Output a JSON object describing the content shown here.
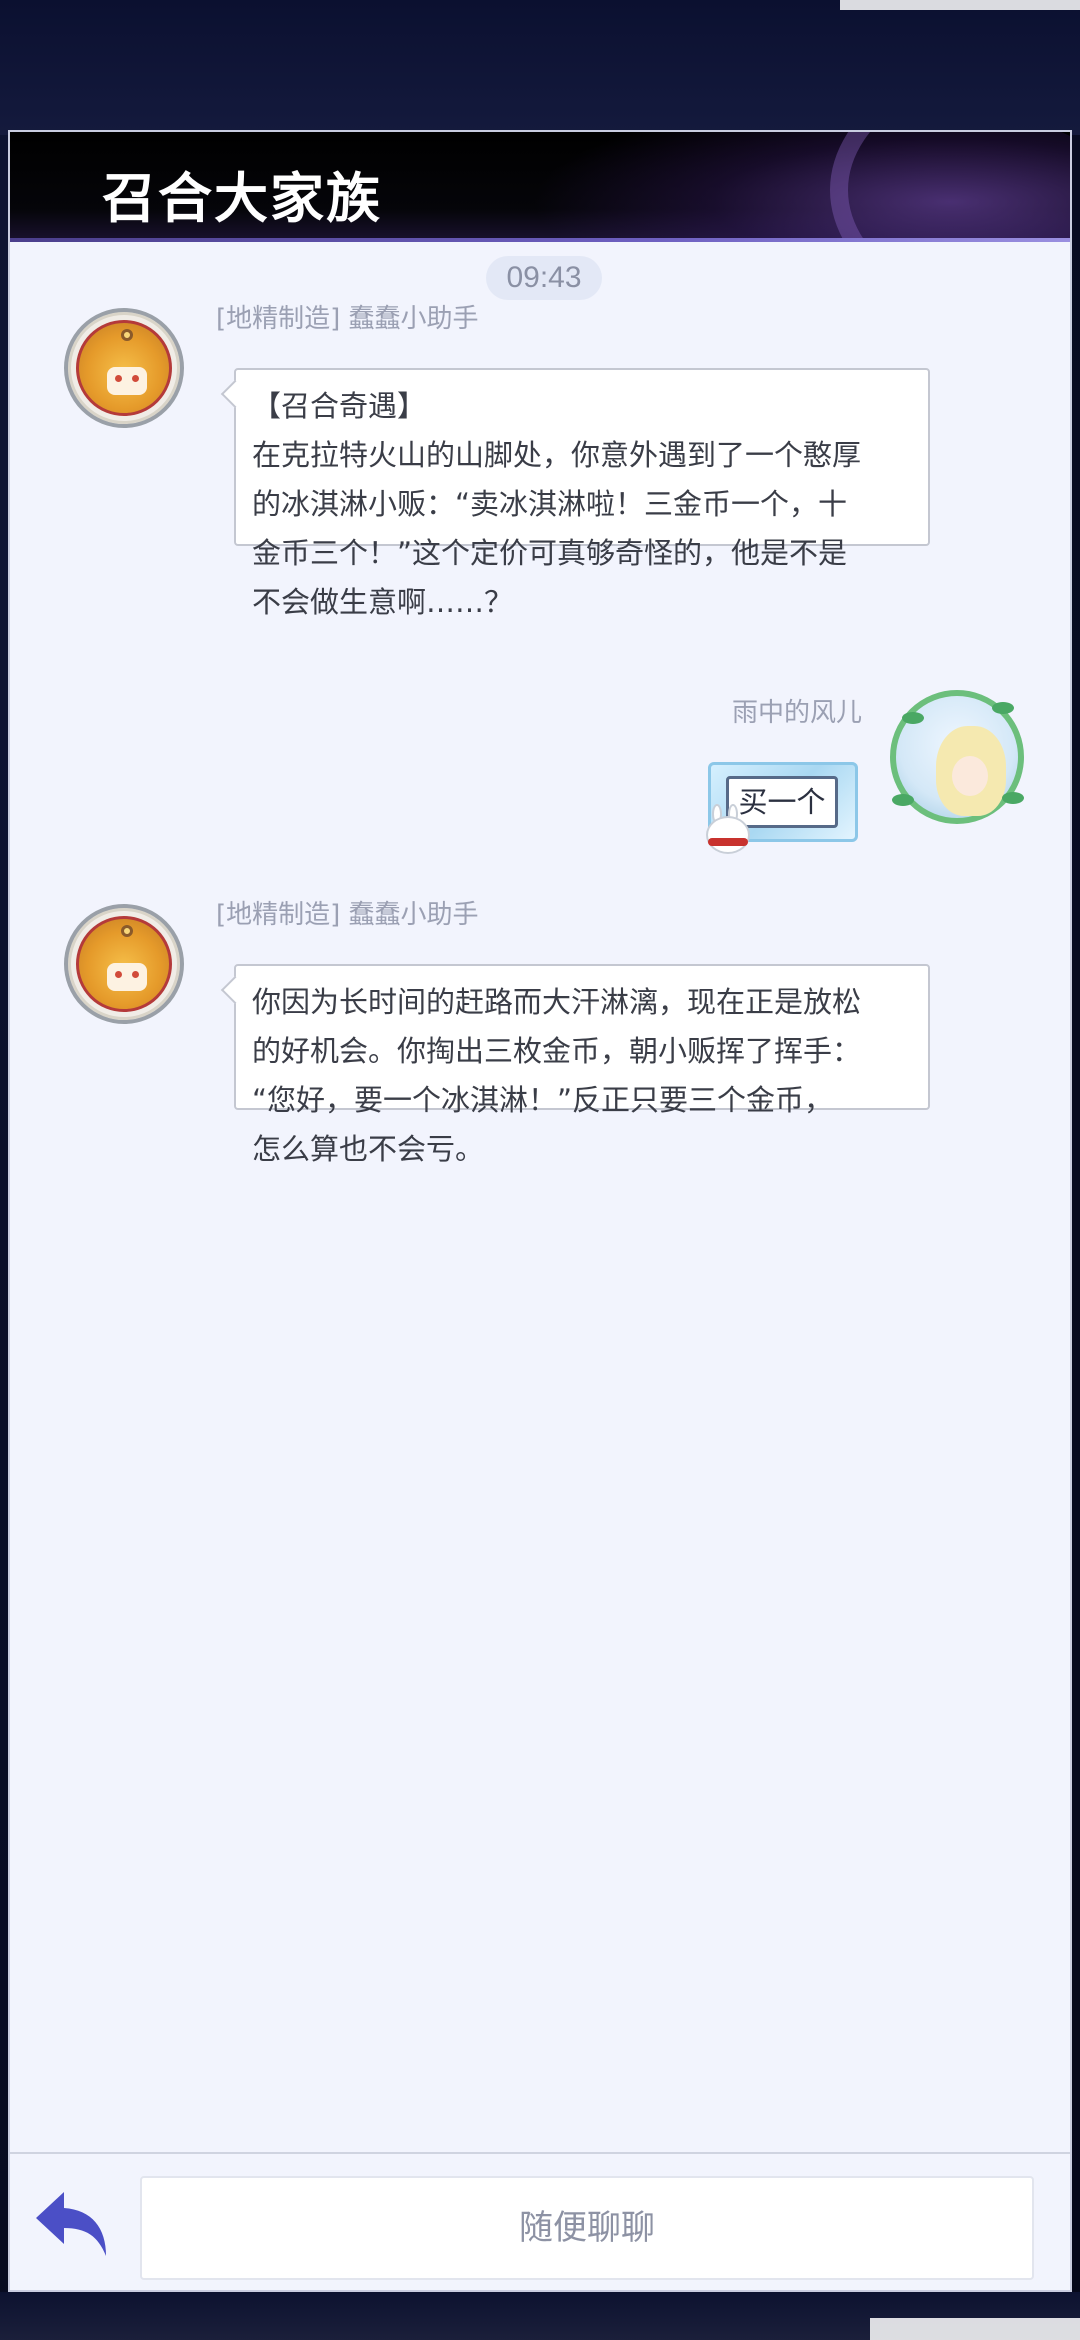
{
  "header": {
    "title": "召合大家族"
  },
  "chat": {
    "timestamp": "09:43",
    "messages": [
      {
        "sender": "[地精制造] 蠢蠢小助手",
        "lines": [
          "【召合奇遇】",
          "在克拉特火山的山脚处，你意外遇到了一个憨厚",
          "的冰淇淋小贩：“卖冰淇淋啦！三金币一个，十",
          "金币三个！”这个定价可真够奇怪的，他是不是",
          "不会做生意啊……？"
        ]
      },
      {
        "sender": "雨中的风儿",
        "text": "买一个"
      },
      {
        "sender": "[地精制造] 蠢蠢小助手",
        "lines": [
          "你因为长时间的赶路而大汗淋漓，现在正是放松",
          "的好机会。你掏出三枚金币，朝小贩挥了挥手：",
          "“您好，要一个冰淇淋！”反正只要三个金币，",
          "怎么算也不会亏。"
        ]
      }
    ]
  },
  "input": {
    "placeholder": "随便聊聊"
  },
  "icons": {
    "back": "back-arrow-icon"
  },
  "colors": {
    "back_arrow": "#4b4fc6",
    "panel_bg": "#f2f4fd",
    "header_bg": "#000000"
  }
}
